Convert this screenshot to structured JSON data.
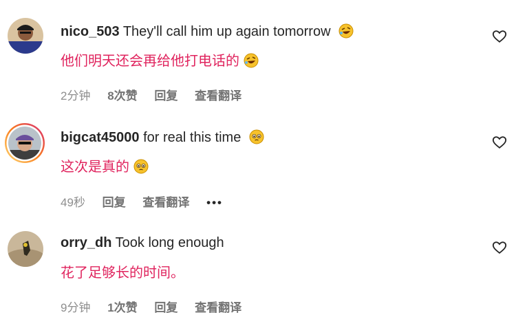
{
  "comments": [
    {
      "username": "nico_503",
      "text": "They'll call him up again tomorrow",
      "emoji": "rolling-on-floor-laughing",
      "translation": "他们明天还会再给他打电话的",
      "time": "2分钟",
      "likes": "8次赞",
      "reply": "回复",
      "see_translation": "查看翻译"
    },
    {
      "username": "bigcat45000",
      "text": "for real this time",
      "emoji": "pleading-face",
      "translation": "这次是真的",
      "time": "49秒",
      "reply": "回复",
      "see_translation": "查看翻译",
      "more": "•••"
    },
    {
      "username": "orry_dh",
      "text": "Took long enough",
      "translation": "花了足够长的时间。",
      "time": "9分钟",
      "likes": "1次赞",
      "reply": "回复",
      "see_translation": "查看翻译"
    }
  ],
  "colors": {
    "translation": "#e0245e",
    "meta": "#8e8e8e",
    "text": "#262626",
    "story_ring_start": "#feda75",
    "story_ring_end": "#d62976"
  }
}
